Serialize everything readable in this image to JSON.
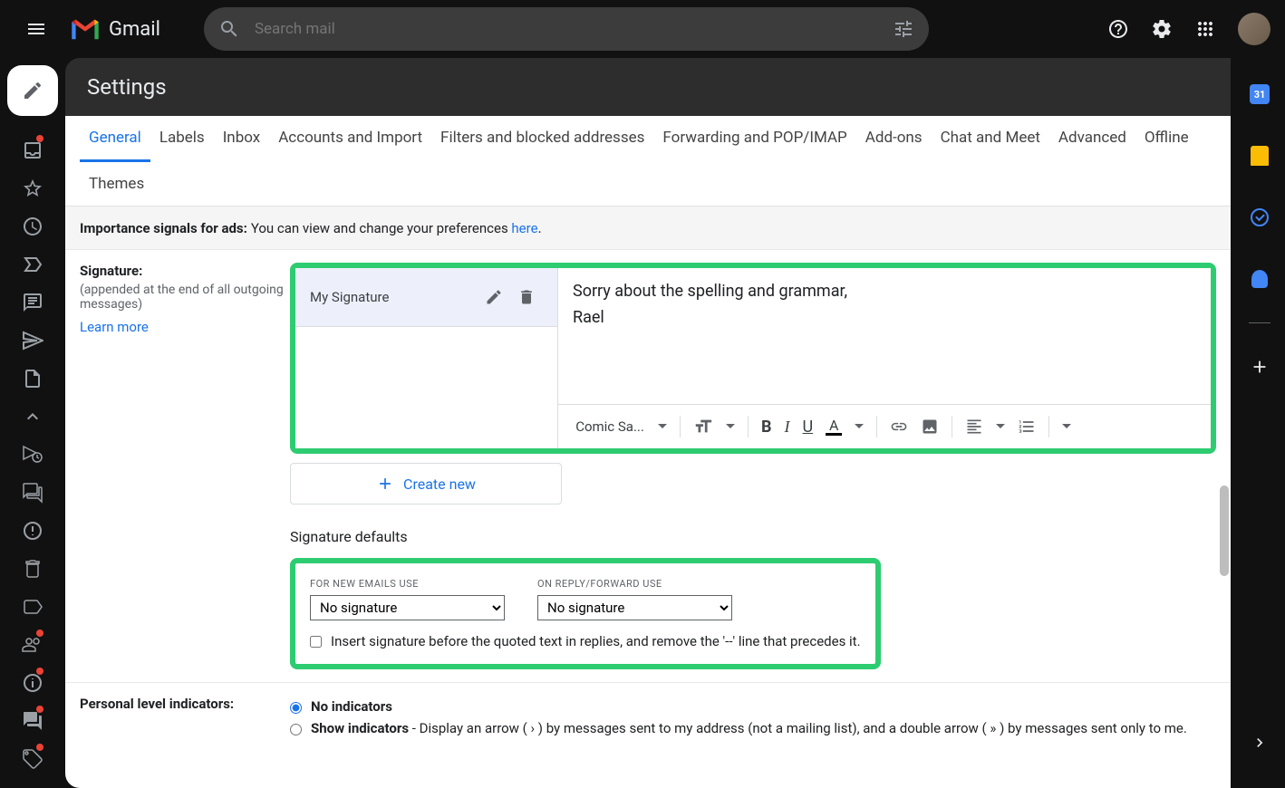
{
  "header": {
    "logoText": "Gmail",
    "searchPlaceholder": "Search mail"
  },
  "settings": {
    "title": "Settings",
    "tabs": [
      "General",
      "Labels",
      "Inbox",
      "Accounts and Import",
      "Filters and blocked addresses",
      "Forwarding and POP/IMAP",
      "Add-ons",
      "Chat and Meet",
      "Advanced",
      "Offline",
      "Themes"
    ],
    "activeTab": 0
  },
  "adsSection": {
    "label": "Importance signals for ads:",
    "text": "You can view and change your preferences ",
    "linkText": "here",
    "period": "."
  },
  "signatureSection": {
    "label": "Signature:",
    "desc": "(appended at the end of all outgoing messages)",
    "learnMore": "Learn more",
    "signatureName": "My Signature",
    "signatureLine1": "Sorry about the spelling and grammar,",
    "signatureLine2": "Rael",
    "fontName": "Comic Sa...",
    "createNew": "Create new",
    "defaultsTitle": "Signature defaults",
    "newEmailsLabel": "FOR NEW EMAILS USE",
    "replyForwardLabel": "ON REPLY/FORWARD USE",
    "noSignature": "No signature",
    "insertBeforeText": "Insert signature before the quoted text in replies, and remove the '--' line that precedes it."
  },
  "pliSection": {
    "label": "Personal level indicators:",
    "noIndicators": "No indicators",
    "showIndicators": "Show indicators",
    "showDesc": " - Display an arrow ( › ) by messages sent to my address (not a mailing list), and a double arrow ( » ) by messages sent only to me."
  },
  "rightSidebar": {
    "calendarDay": "31"
  }
}
